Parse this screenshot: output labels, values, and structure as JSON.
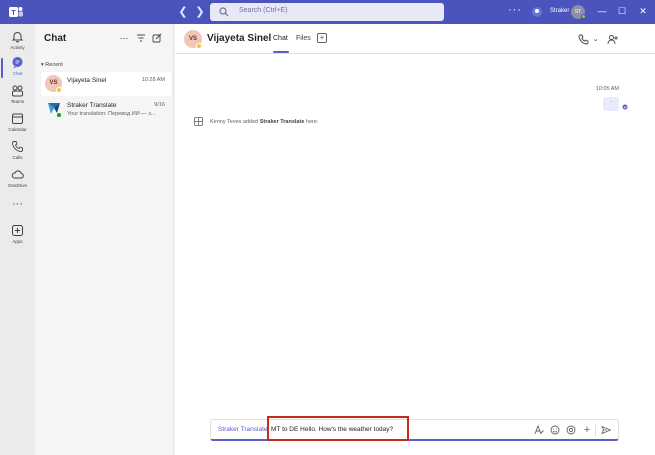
{
  "titlebar": {
    "search_placeholder": "Search (Ctrl+E)",
    "more_label": "···",
    "user_name": "Straker",
    "user_initials": "ST",
    "minimize": "—",
    "maximize": "☐",
    "close": "✕"
  },
  "rail": {
    "items": [
      {
        "label": "Activity"
      },
      {
        "label": "Chat"
      },
      {
        "label": "Teams"
      },
      {
        "label": "Calendar"
      },
      {
        "label": "Calls"
      },
      {
        "label": "OneDrive"
      },
      {
        "label": "···"
      },
      {
        "label": "Apps"
      }
    ]
  },
  "chatlist": {
    "title": "Chat",
    "section": "Recent",
    "items": [
      {
        "initials": "VS",
        "name": "Vijayeta Sinel",
        "time": "10:28 AM",
        "preview": ""
      },
      {
        "name": "Straker Translate",
        "time": "9/16",
        "preview": "Your translation: Перевод ИИ — э..."
      }
    ]
  },
  "header": {
    "initials": "VS",
    "name": "Vijayeta Sinel",
    "tabs": [
      {
        "label": "Chat"
      },
      {
        "label": "Files"
      }
    ]
  },
  "conversation": {
    "time": "10:05 AM",
    "bubble": "·",
    "sys_prefix": "Kenny Teves added ",
    "sys_bold": "Straker Translate",
    "sys_suffix": " here."
  },
  "compose": {
    "mention": "Straker Translate",
    "text": "MT to DE Hello. How's the weather today?"
  },
  "colors": {
    "brand": "#4b53bc",
    "accent": "#5b5fc7",
    "highlight_box": "#c42b1c"
  }
}
